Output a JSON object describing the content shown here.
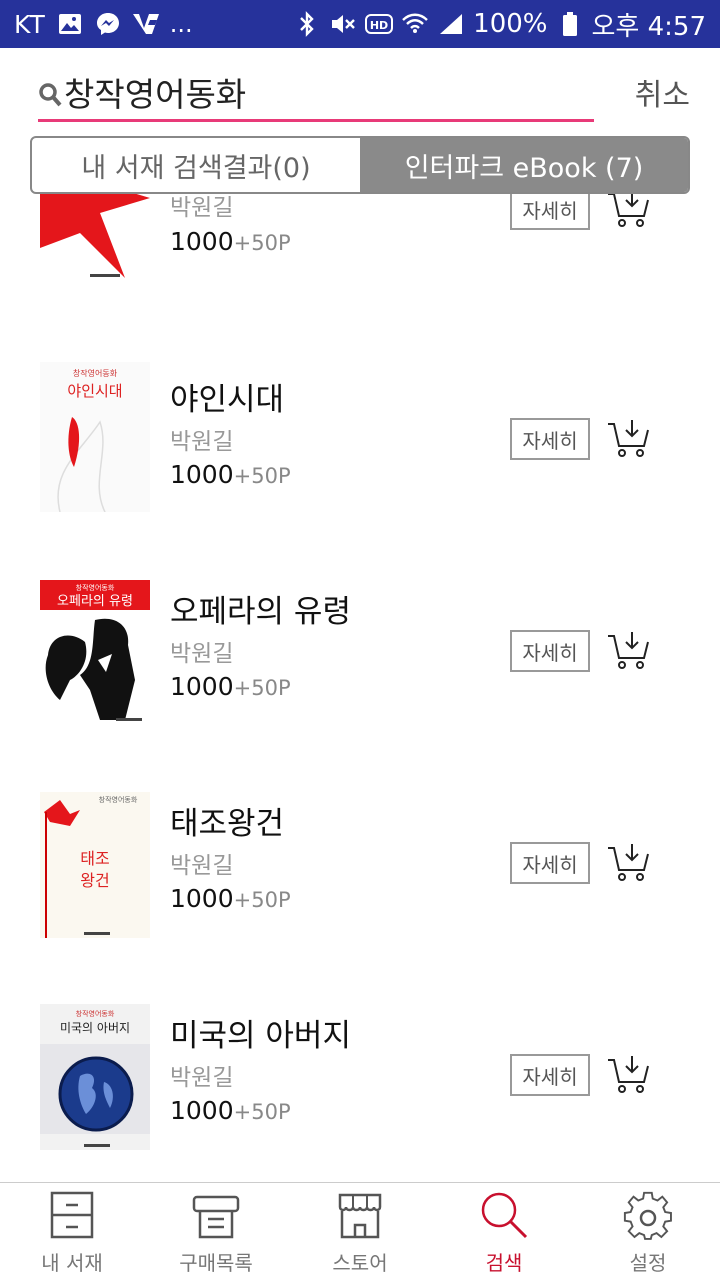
{
  "status_bar": {
    "carrier": "KT",
    "more": "...",
    "battery": "100%",
    "time": "오후 4:57"
  },
  "search": {
    "query": "창작영어동화",
    "cancel_label": "취소"
  },
  "tabs": [
    {
      "label": "내 서재 검색결과(0)",
      "active": false
    },
    {
      "label": "인터파크 eBook (7)",
      "active": true
    }
  ],
  "results": [
    {
      "title": "",
      "author": "박원길",
      "price": "1000",
      "points": "+50P",
      "detail_label": "자세히",
      "cover": "red-bird"
    },
    {
      "title": "야인시대",
      "author": "박원길",
      "price": "1000",
      "points": "+50P",
      "detail_label": "자세히",
      "cover": "yain-sidae",
      "cover_text": [
        "창작영어동화",
        "야인시대"
      ]
    },
    {
      "title": "오페라의 유령",
      "author": "박원길",
      "price": "1000",
      "points": "+50P",
      "detail_label": "자세히",
      "cover": "opera-phantom",
      "cover_text": [
        "창작영어동화",
        "오페라의 유령"
      ]
    },
    {
      "title": "태조왕건",
      "author": "박원길",
      "price": "1000",
      "points": "+50P",
      "detail_label": "자세히",
      "cover": "taejo-wanggeon",
      "cover_text": [
        "창작영어동화",
        "태조",
        "왕건"
      ]
    },
    {
      "title": "미국의 아버지",
      "author": "박원길",
      "price": "1000",
      "points": "+50P",
      "detail_label": "자세히",
      "cover": "father-america",
      "cover_text": [
        "창작영어동화",
        "미국의 아버지"
      ]
    }
  ],
  "bottom_nav": [
    {
      "label": "내 서재",
      "icon": "bookshelf-icon",
      "active": false
    },
    {
      "label": "구매목록",
      "icon": "receipt-icon",
      "active": false
    },
    {
      "label": "스토어",
      "icon": "store-icon",
      "active": false
    },
    {
      "label": "검색",
      "icon": "search-icon",
      "active": true
    },
    {
      "label": "설정",
      "icon": "gear-icon",
      "active": false
    }
  ],
  "colors": {
    "status_bar": "#26329b",
    "accent": "#e83a78",
    "active_nav": "#c8102e",
    "active_tab": "#8a8a8a"
  }
}
